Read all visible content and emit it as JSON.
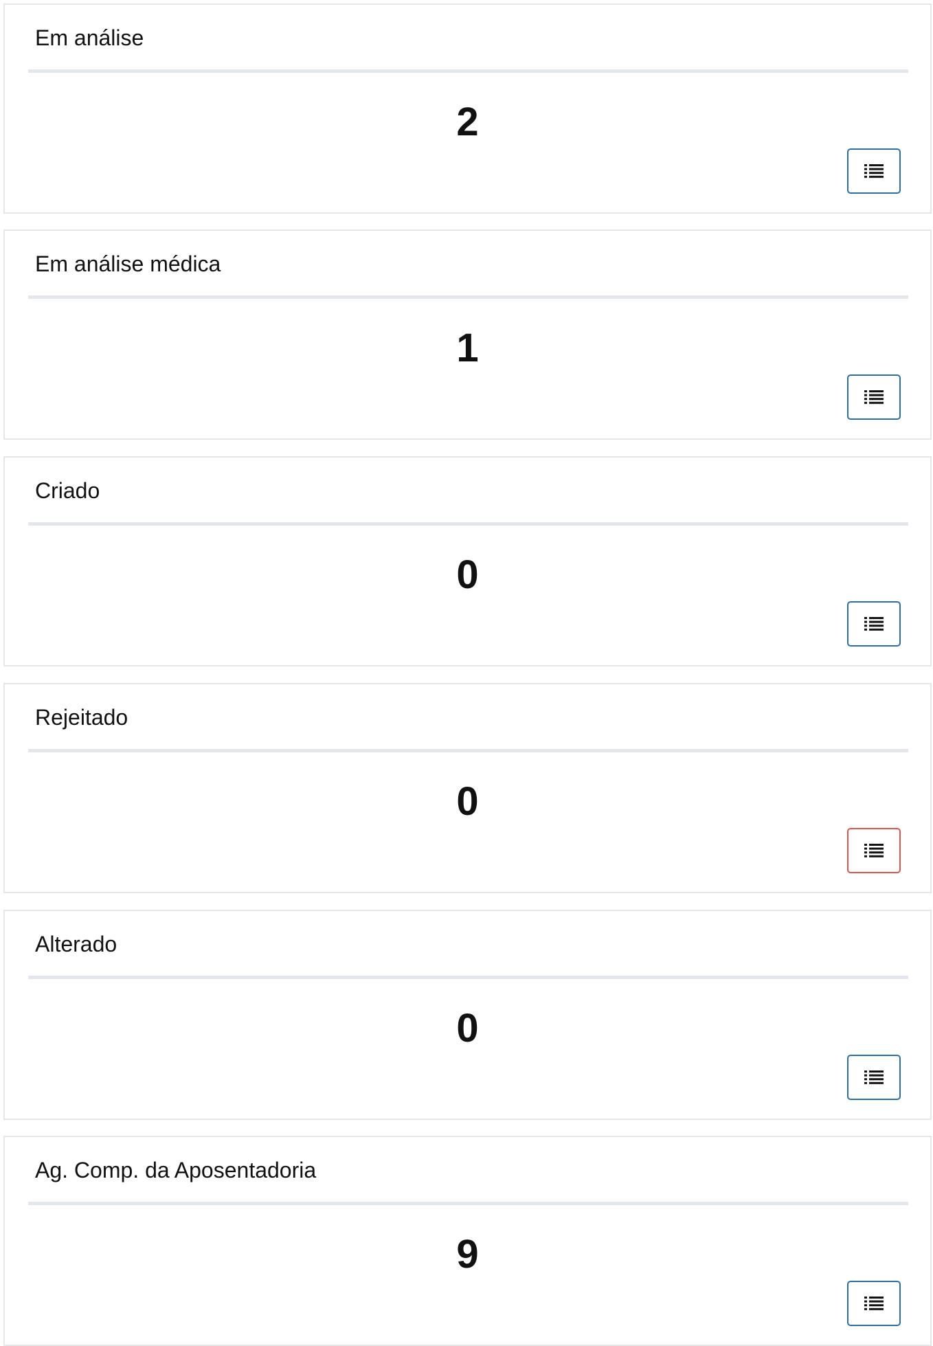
{
  "cards": [
    {
      "title": "Em análise",
      "count": "2",
      "button_icon": "list-icon",
      "button_color": "#2e6da4"
    },
    {
      "title": "Em análise médica",
      "count": "1",
      "button_icon": "list-icon",
      "button_color": "#2e6da4"
    },
    {
      "title": "Criado",
      "count": "0",
      "button_icon": "list-icon",
      "button_color": "#2e6da4"
    },
    {
      "title": "Rejeitado",
      "count": "0",
      "button_icon": "list-icon",
      "button_color": "#d9534f"
    },
    {
      "title": "Alterado",
      "count": "0",
      "button_icon": "list-icon",
      "button_color": "#2e6da4"
    },
    {
      "title": "Ag. Comp. da Aposentadoria",
      "count": "9",
      "button_icon": "list-icon",
      "button_color": "#2e6da4"
    }
  ]
}
